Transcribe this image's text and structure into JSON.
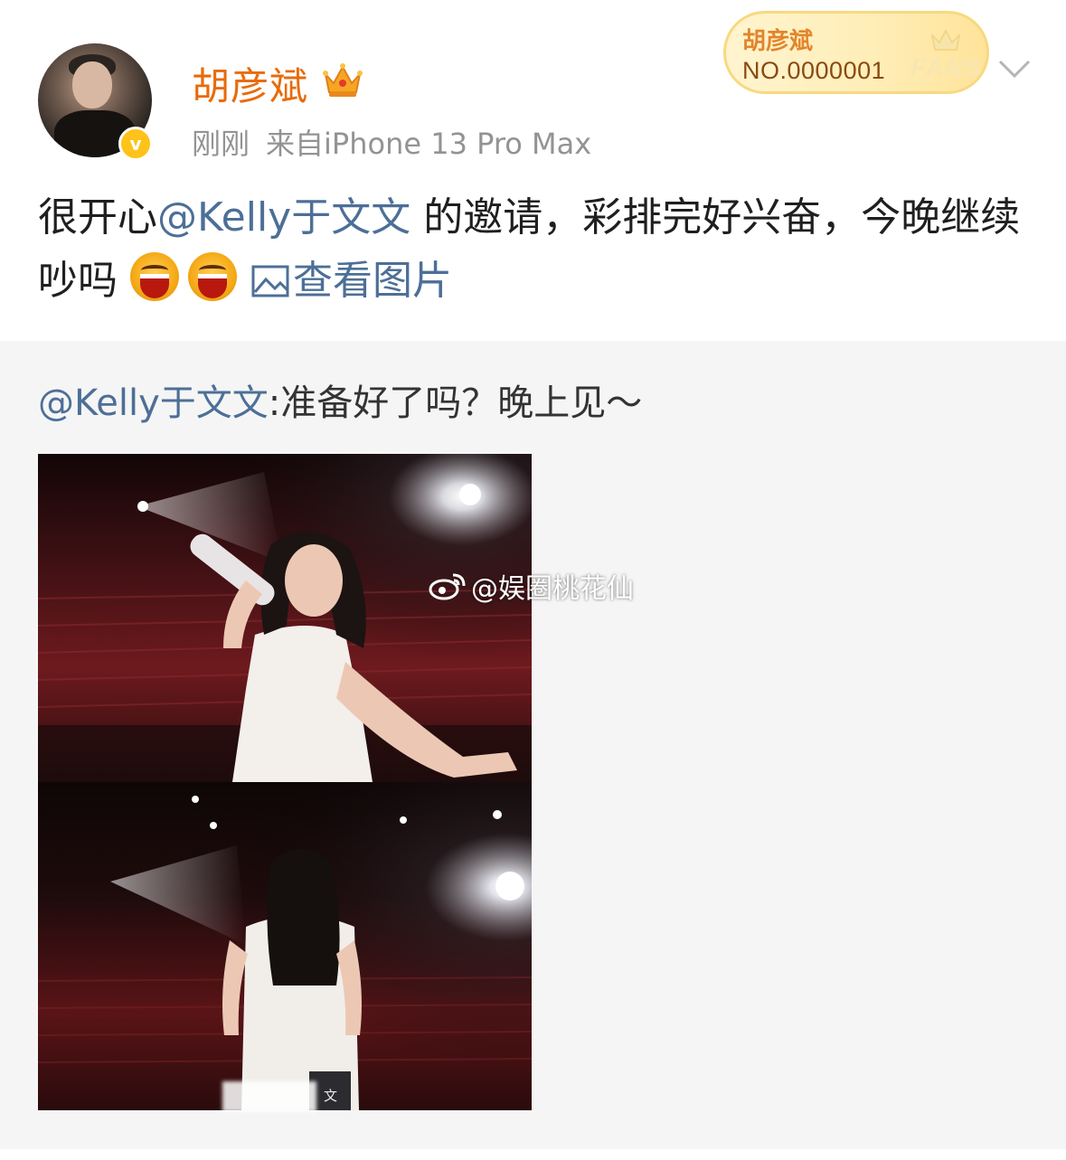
{
  "post": {
    "author": "胡彦斌",
    "time": "刚刚",
    "source": "来自iPhone 13 Pro Max",
    "text_before": "很开心",
    "mention": "@Kelly于文文",
    "text_after": " 的邀请，彩排完好兴奋，今晚继续吵吗",
    "emojis": [
      "laughing-emoji",
      "laughing-emoji"
    ],
    "image_link": "查看图片",
    "verified": true
  },
  "fans_badge": {
    "name": "胡彦斌",
    "number": "NO.0000001",
    "word": "FANS"
  },
  "repost": {
    "mention": "@Kelly于文文",
    "text": ":准备好了吗？晚上见～",
    "watermark": "@娱圈桃花仙",
    "caption": "文"
  },
  "colors": {
    "username": "#e86b0b",
    "link": "#4d6f97",
    "meta": "#939393",
    "repost_bg": "#f5f5f5",
    "verified": "#ffc21a"
  },
  "icons": [
    "crown-icon",
    "verified-icon",
    "chevron-down-icon",
    "picture-icon",
    "weibo-logo-icon"
  ]
}
